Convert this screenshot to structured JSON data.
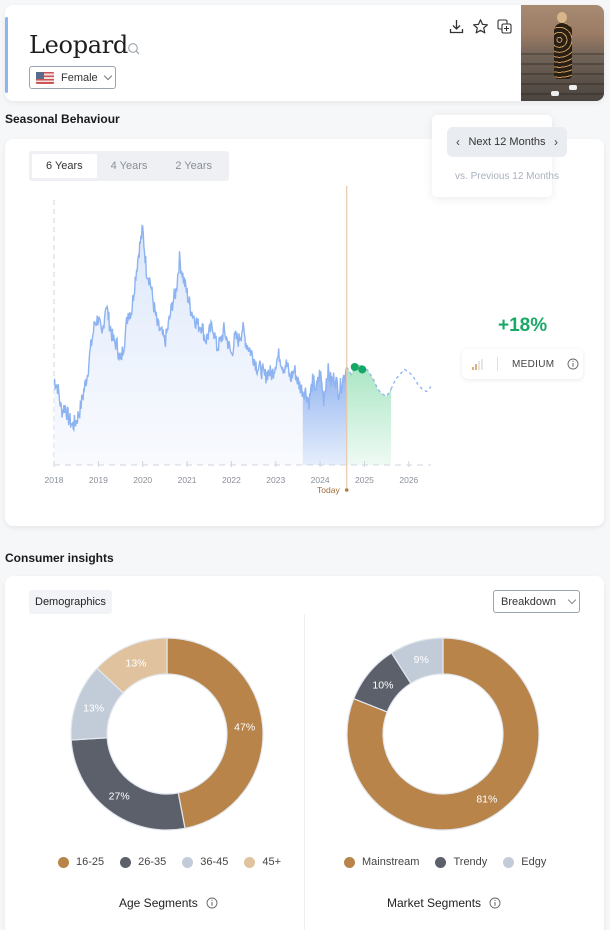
{
  "header": {
    "title": "Leopard",
    "gender_select": {
      "value": "Female",
      "flag": "us-flag"
    },
    "actions": [
      {
        "name": "download",
        "icon": "download-icon"
      },
      {
        "name": "favorite",
        "icon": "star-icon"
      },
      {
        "name": "add-to-collection",
        "icon": "copy-add-icon"
      }
    ],
    "image_alt": "woman in leopard print dress walking on steps"
  },
  "seasonal": {
    "section_title": "Seasonal Behaviour",
    "period_tabs": [
      {
        "label": "6 Years",
        "active": true
      },
      {
        "label": "4 Years",
        "active": false
      },
      {
        "label": "2 Years",
        "active": false
      }
    ],
    "period_nav": {
      "label": "Next 12 Months",
      "prev": "‹",
      "next": "›"
    },
    "compare_label": "vs. Previous 12 Months",
    "growth": "+18%",
    "level": "MEDIUM",
    "level_bars_filled": 2,
    "level_bars_total": 4,
    "today_label": "Today"
  },
  "chart_data": [
    {
      "type": "area",
      "title": "Seasonal Behaviour",
      "xlabel": "",
      "ylabel": "",
      "x_ticks": [
        "2018",
        "2019",
        "2020",
        "2021",
        "2022",
        "2023",
        "2024",
        "2025",
        "2026"
      ],
      "xlim": [
        2018.0,
        2026.5
      ],
      "ylim": [
        0,
        100
      ],
      "today": 2024.6,
      "grid": false,
      "series": [
        {
          "name": "historical",
          "color": "#8db3f0",
          "x": [
            2018.0,
            2018.08,
            2018.17,
            2018.25,
            2018.33,
            2018.42,
            2018.5,
            2018.58,
            2018.67,
            2018.75,
            2018.83,
            2018.92,
            2019.0,
            2019.08,
            2019.17,
            2019.25,
            2019.33,
            2019.42,
            2019.5,
            2019.58,
            2019.67,
            2019.75,
            2019.83,
            2019.92,
            2020.0,
            2020.08,
            2020.17,
            2020.25,
            2020.33,
            2020.42,
            2020.5,
            2020.58,
            2020.67,
            2020.75,
            2020.83,
            2020.92,
            2021.0,
            2021.08,
            2021.17,
            2021.25,
            2021.33,
            2021.42,
            2021.5,
            2021.58,
            2021.67,
            2021.75,
            2021.83,
            2021.92,
            2022.0,
            2022.08,
            2022.17,
            2022.25,
            2022.33,
            2022.42,
            2022.5,
            2022.58,
            2022.67,
            2022.75,
            2022.83,
            2022.92,
            2023.0,
            2023.08,
            2023.17,
            2023.25,
            2023.33,
            2023.42,
            2023.5,
            2023.58,
            2023.67,
            2023.75,
            2023.83,
            2023.92,
            2024.0,
            2024.08,
            2024.17,
            2024.25,
            2024.33,
            2024.42,
            2024.5,
            2024.6
          ],
          "values": [
            35,
            32,
            22,
            24,
            19,
            16,
            18,
            22,
            30,
            37,
            48,
            58,
            60,
            52,
            66,
            58,
            51,
            49,
            42,
            50,
            62,
            63,
            76,
            88,
            96,
            80,
            75,
            65,
            57,
            54,
            50,
            57,
            66,
            71,
            84,
            76,
            70,
            64,
            60,
            57,
            57,
            51,
            54,
            57,
            48,
            50,
            55,
            50,
            45,
            52,
            51,
            56,
            50,
            47,
            44,
            40,
            39,
            36,
            38,
            37,
            42,
            45,
            40,
            41,
            35,
            39,
            34,
            31,
            30,
            26,
            34,
            31,
            38,
            27,
            39,
            34,
            36,
            30,
            34,
            40
          ]
        },
        {
          "name": "forecast",
          "color": "#22b06a",
          "x": [
            2024.6,
            2024.7,
            2024.8,
            2024.9,
            2025.0,
            2025.1,
            2025.2,
            2025.3,
            2025.4,
            2025.5,
            2025.6
          ],
          "values": [
            40,
            37,
            40,
            41,
            40,
            38,
            35,
            31,
            29,
            28,
            31
          ]
        },
        {
          "name": "forecast-extended",
          "style": "dashed",
          "x": [
            2025.6,
            2025.7,
            2025.8,
            2025.9,
            2026.0,
            2026.1,
            2026.2,
            2026.3,
            2026.4,
            2026.5
          ],
          "values": [
            31,
            35,
            37,
            39,
            38,
            36,
            33,
            31,
            30,
            32
          ]
        }
      ],
      "highlight_points": [
        {
          "x": 2024.78,
          "value": 40
        },
        {
          "x": 2024.95,
          "value": 39
        }
      ]
    },
    {
      "type": "pie",
      "title": "Age Segments",
      "categories": [
        "16-25",
        "26-35",
        "36-45",
        "45+"
      ],
      "values": [
        47,
        27,
        13,
        13
      ],
      "colors": [
        "#b8844a",
        "#5c606b",
        "#c2ccd8",
        "#e0c39e"
      ],
      "legend": "bottom"
    },
    {
      "type": "pie",
      "title": "Market Segments",
      "categories": [
        "Mainstream",
        "Trendy",
        "Edgy"
      ],
      "values": [
        81,
        10,
        9
      ],
      "colors": [
        "#b8844a",
        "#5c606b",
        "#c2ccd8"
      ],
      "legend": "bottom"
    }
  ],
  "insights": {
    "section_title": "Consumer insights",
    "tab_label": "Demographics",
    "breakdown_select": "Breakdown",
    "age": {
      "title": "Age Segments"
    },
    "market": {
      "title": "Market Segments"
    }
  }
}
